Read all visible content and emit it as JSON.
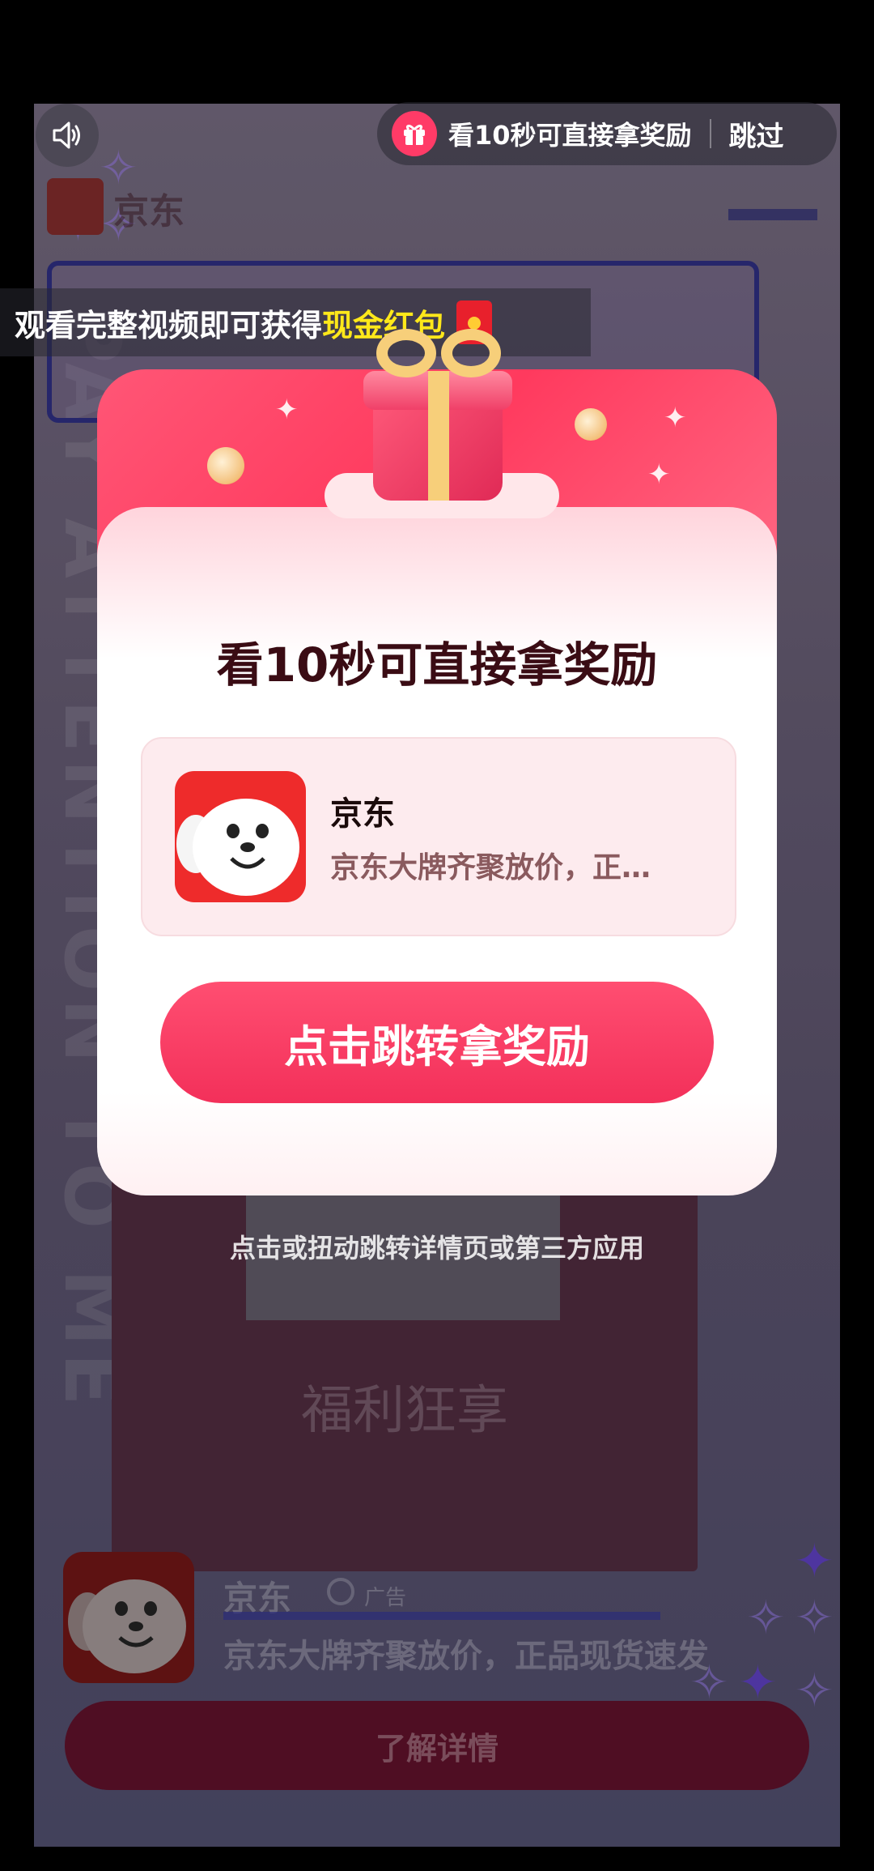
{
  "top_bar": {
    "sound_icon": "speaker-icon",
    "reward_text": "看10秒可直接拿奖励",
    "skip_label": "跳过",
    "gift_icon": "gift-icon"
  },
  "banner": {
    "prefix": "观看完整视频即可获得",
    "highlight": "现金红包",
    "icon": "red-envelope-icon"
  },
  "dialog": {
    "title": "看10秒可直接拿奖励",
    "app": {
      "name": "京东",
      "description": "京东大牌齐聚放价，正…"
    },
    "cta_label": "点击跳转拿奖励"
  },
  "hint": "点击或扭动跳转详情页或第三方应用",
  "background_ad": {
    "slogan": "福利狂享",
    "top_title": "京东",
    "app_name": "京东",
    "ad_tag": "广告",
    "description": "京东大牌齐聚放价，正品现货速发",
    "cta_label": "了解详情",
    "vertical_slogan": "PAY ATTENTION TO ME"
  },
  "colors": {
    "accent": "#ff3a5e",
    "highlight": "#ffe81a",
    "title": "#3a0c14"
  }
}
